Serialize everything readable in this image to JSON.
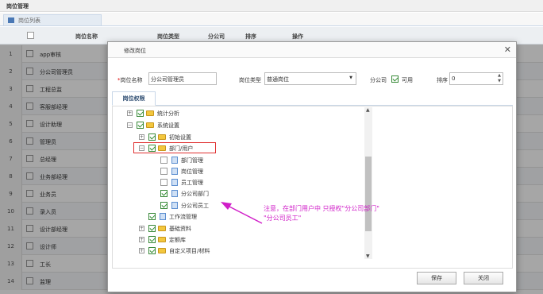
{
  "page": {
    "title": "岗位管理"
  },
  "list_tab": {
    "label": "岗位列表"
  },
  "grid": {
    "columns": [
      "岗位名称",
      "岗位类型",
      "分公司",
      "排序",
      "操作"
    ],
    "rows": [
      {
        "num": "1",
        "name": "app审核"
      },
      {
        "num": "2",
        "name": "分公司管理员"
      },
      {
        "num": "3",
        "name": "工程总监"
      },
      {
        "num": "4",
        "name": "客服部经理"
      },
      {
        "num": "5",
        "name": "设计助理"
      },
      {
        "num": "6",
        "name": "管理员"
      },
      {
        "num": "7",
        "name": "总经理"
      },
      {
        "num": "8",
        "name": "业务部经理"
      },
      {
        "num": "9",
        "name": "业务员"
      },
      {
        "num": "10",
        "name": "录入员"
      },
      {
        "num": "11",
        "name": "设计部经理"
      },
      {
        "num": "12",
        "name": "设计师"
      },
      {
        "num": "13",
        "name": "工长"
      },
      {
        "num": "14",
        "name": "监理"
      }
    ]
  },
  "modal": {
    "title": "修改岗位",
    "name_label": "岗位名称",
    "name_value": "分公司管理员",
    "type_label": "岗位类型",
    "type_value": "普通岗位",
    "branch_label": "分公司",
    "branch_available": "可用",
    "sort_label": "排序",
    "sort_value": "0",
    "tab_label": "岗位权限",
    "tree": [
      {
        "label": "统计分析",
        "expander": "+",
        "checked": true,
        "icon": "folder-icon"
      },
      {
        "label": "系统设置",
        "expander": "−",
        "checked": true,
        "icon": "folder-icon"
      },
      {
        "label": "初始设置",
        "expander": "+",
        "checked": true,
        "icon": "folder-icon"
      },
      {
        "label": "部门/用户",
        "expander": "−",
        "checked": true,
        "icon": "folder-icon"
      },
      {
        "label": "部门管理",
        "expander": "",
        "checked": false,
        "icon": "file-icon"
      },
      {
        "label": "岗位管理",
        "expander": "",
        "checked": false,
        "icon": "file-icon"
      },
      {
        "label": "员工管理",
        "expander": "",
        "checked": false,
        "icon": "file-icon"
      },
      {
        "label": "分公司部门",
        "expander": "",
        "checked": true,
        "icon": "file-icon"
      },
      {
        "label": "分公司员工",
        "expander": "",
        "checked": true,
        "icon": "file-icon"
      },
      {
        "label": "工作流管理",
        "expander": "",
        "checked": true,
        "icon": "file-icon"
      },
      {
        "label": "基础资料",
        "expander": "+",
        "checked": true,
        "icon": "folder-icon"
      },
      {
        "label": "定额库",
        "expander": "+",
        "checked": true,
        "icon": "folder-icon"
      },
      {
        "label": "自定义项目/材料",
        "expander": "+",
        "checked": true,
        "icon": "folder-icon"
      }
    ],
    "save_label": "保存",
    "close_label": "关闭"
  },
  "annotation": {
    "line1": "注意，在部门用户中 只授权\"分公司部门\"",
    "line2": "\"分公司员工\"",
    "color": "#d01ec8"
  }
}
